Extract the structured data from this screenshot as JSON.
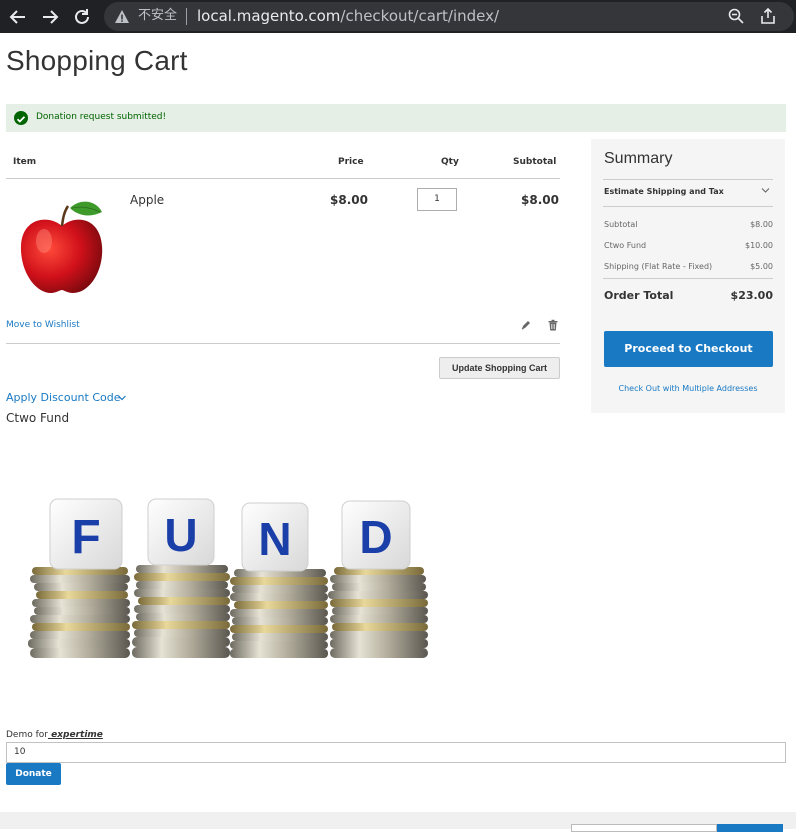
{
  "browser": {
    "security_label": "不安全",
    "url_host": "local.magento.com",
    "url_path": "/checkout/cart/index/"
  },
  "page": {
    "title": "Shopping Cart",
    "message": "Donation request submitted!"
  },
  "cart": {
    "headers": {
      "item": "Item",
      "price": "Price",
      "qty": "Qty",
      "subtotal": "Subtotal"
    },
    "items": [
      {
        "name": "Apple",
        "price": "$8.00",
        "qty": "1",
        "subtotal": "$8.00"
      }
    ],
    "move_to_wishlist": "Move to Wishlist",
    "update_button": "Update Shopping Cart",
    "discount_label": "Apply Discount Code"
  },
  "fund": {
    "title": "Ctwo Fund",
    "demo_label_prefix": "Demo for",
    "demo_label_name": " expertime ",
    "amount": "10",
    "donate_button": "Donate"
  },
  "summary": {
    "title": "Summary",
    "estimate_label": "Estimate Shipping and Tax",
    "rows": [
      {
        "label": "Subtotal",
        "value": "$8.00"
      },
      {
        "label": "Ctwo Fund",
        "value": "$10.00"
      },
      {
        "label": "Shipping (Flat Rate - Fixed)",
        "value": "$5.00"
      }
    ],
    "order_total_label": "Order Total",
    "order_total_value": "$23.00",
    "checkout_button": "Proceed to Checkout",
    "multi_address_link": "Check Out with Multiple Addresses"
  },
  "colors": {
    "accent": "#1979c3",
    "success_bg": "#e5efe5",
    "success_text": "#006400"
  }
}
